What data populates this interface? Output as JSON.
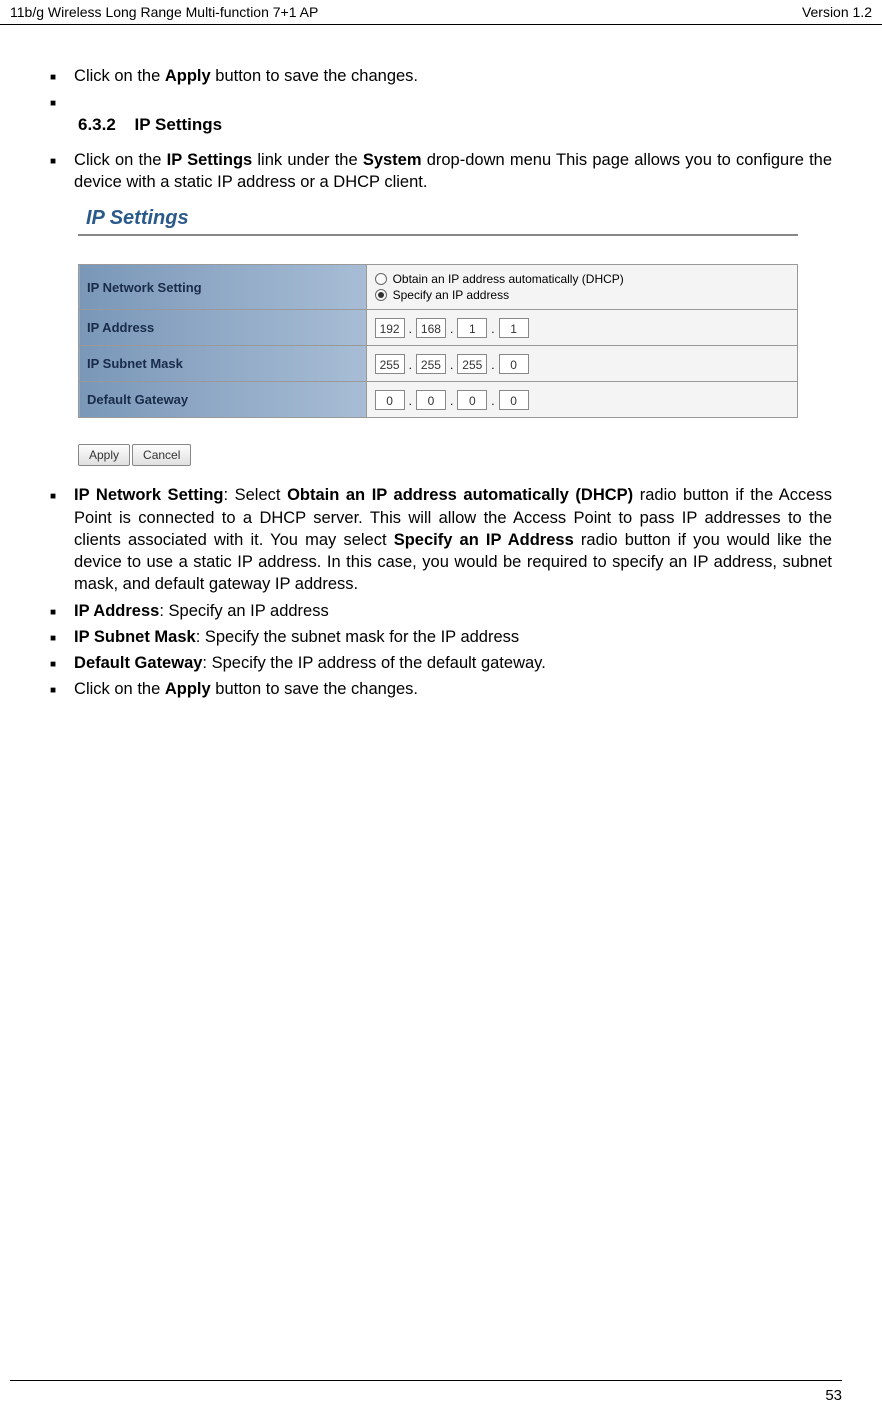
{
  "header": {
    "left": "11b/g Wireless Long Range Multi-function 7+1 AP",
    "right": "Version 1.2"
  },
  "bullets": {
    "b1_pre": "Click on the ",
    "b1_bold": "Apply",
    "b1_post": " button to save the changes.",
    "b2_pre": "Click on the ",
    "b2_bold1": "IP Settings",
    "b2_mid": " link under the ",
    "b2_bold2": "System",
    "b2_post": " drop-down menu This page allows you to configure the device with a static IP address or a DHCP client.",
    "b3_bold1": "IP Network Setting",
    "b3_t1": ": Select ",
    "b3_bold2": "Obtain an IP address automatically (DHCP)",
    "b3_t2": " radio button if the Access Point is connected to a DHCP server. This will allow the Access Point to pass IP addresses to the clients associated with it. You may select ",
    "b3_bold3": "Specify an IP Address",
    "b3_t3": " radio button if you would like the device to use a static IP address. In this case, you would be required to specify an IP address, subnet mask, and default gateway IP address.",
    "b4_bold": "IP Address",
    "b4_post": ": Specify an IP address",
    "b5_bold": "IP Subnet Mask",
    "b5_post": ": Specify the subnet mask for the IP address",
    "b6_bold": "Default Gateway",
    "b6_post": ": Specify the IP address of the default gateway.",
    "b7_pre": "Click on the ",
    "b7_bold": "Apply",
    "b7_post": " button to save the changes."
  },
  "section": {
    "number": "6.3.2",
    "title": "IP Settings"
  },
  "screenshot": {
    "title": "IP Settings",
    "rows": {
      "network_setting_label": "IP Network Setting",
      "radio1": "Obtain an IP address automatically (DHCP)",
      "radio2": "Specify an IP address",
      "ip_address_label": "IP Address",
      "ip_address": [
        "192",
        "168",
        "1",
        "1"
      ],
      "subnet_label": "IP Subnet Mask",
      "subnet": [
        "255",
        "255",
        "255",
        "0"
      ],
      "gateway_label": "Default Gateway",
      "gateway": [
        "0",
        "0",
        "0",
        "0"
      ]
    },
    "buttons": {
      "apply": "Apply",
      "cancel": "Cancel"
    }
  },
  "footer": {
    "page": "53"
  }
}
